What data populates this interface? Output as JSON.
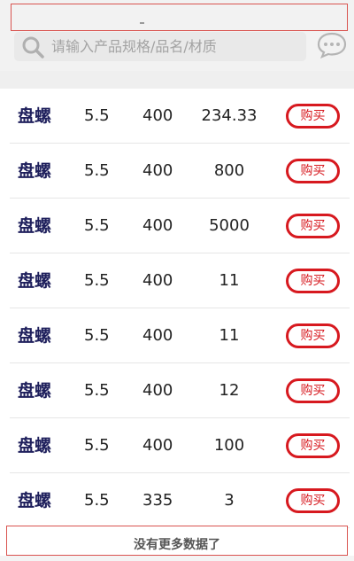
{
  "search": {
    "placeholder": "请输入产品规格/品名/材质",
    "icon": "search-icon"
  },
  "header": {
    "chat_icon": "chat-bubble-icon"
  },
  "colors": {
    "accent": "#d7191f",
    "name_text": "#1e1f5c",
    "search_bg": "#e9e9e9"
  },
  "products": [
    {
      "name": "盘螺",
      "spec": "5.5",
      "length": "400",
      "qty": "234.33",
      "buy_label": "购买"
    },
    {
      "name": "盘螺",
      "spec": "5.5",
      "length": "400",
      "qty": "800",
      "buy_label": "购买"
    },
    {
      "name": "盘螺",
      "spec": "5.5",
      "length": "400",
      "qty": "5000",
      "buy_label": "购买"
    },
    {
      "name": "盘螺",
      "spec": "5.5",
      "length": "400",
      "qty": "11",
      "buy_label": "购买"
    },
    {
      "name": "盘螺",
      "spec": "5.5",
      "length": "400",
      "qty": "11",
      "buy_label": "购买"
    },
    {
      "name": "盘螺",
      "spec": "5.5",
      "length": "400",
      "qty": "12",
      "buy_label": "购买"
    },
    {
      "name": "盘螺",
      "spec": "5.5",
      "length": "400",
      "qty": "100",
      "buy_label": "购买"
    },
    {
      "name": "盘螺",
      "spec": "5.5",
      "length": "335",
      "qty": "3",
      "buy_label": "购买"
    }
  ],
  "footer": {
    "no_more": "没有更多数据了"
  }
}
